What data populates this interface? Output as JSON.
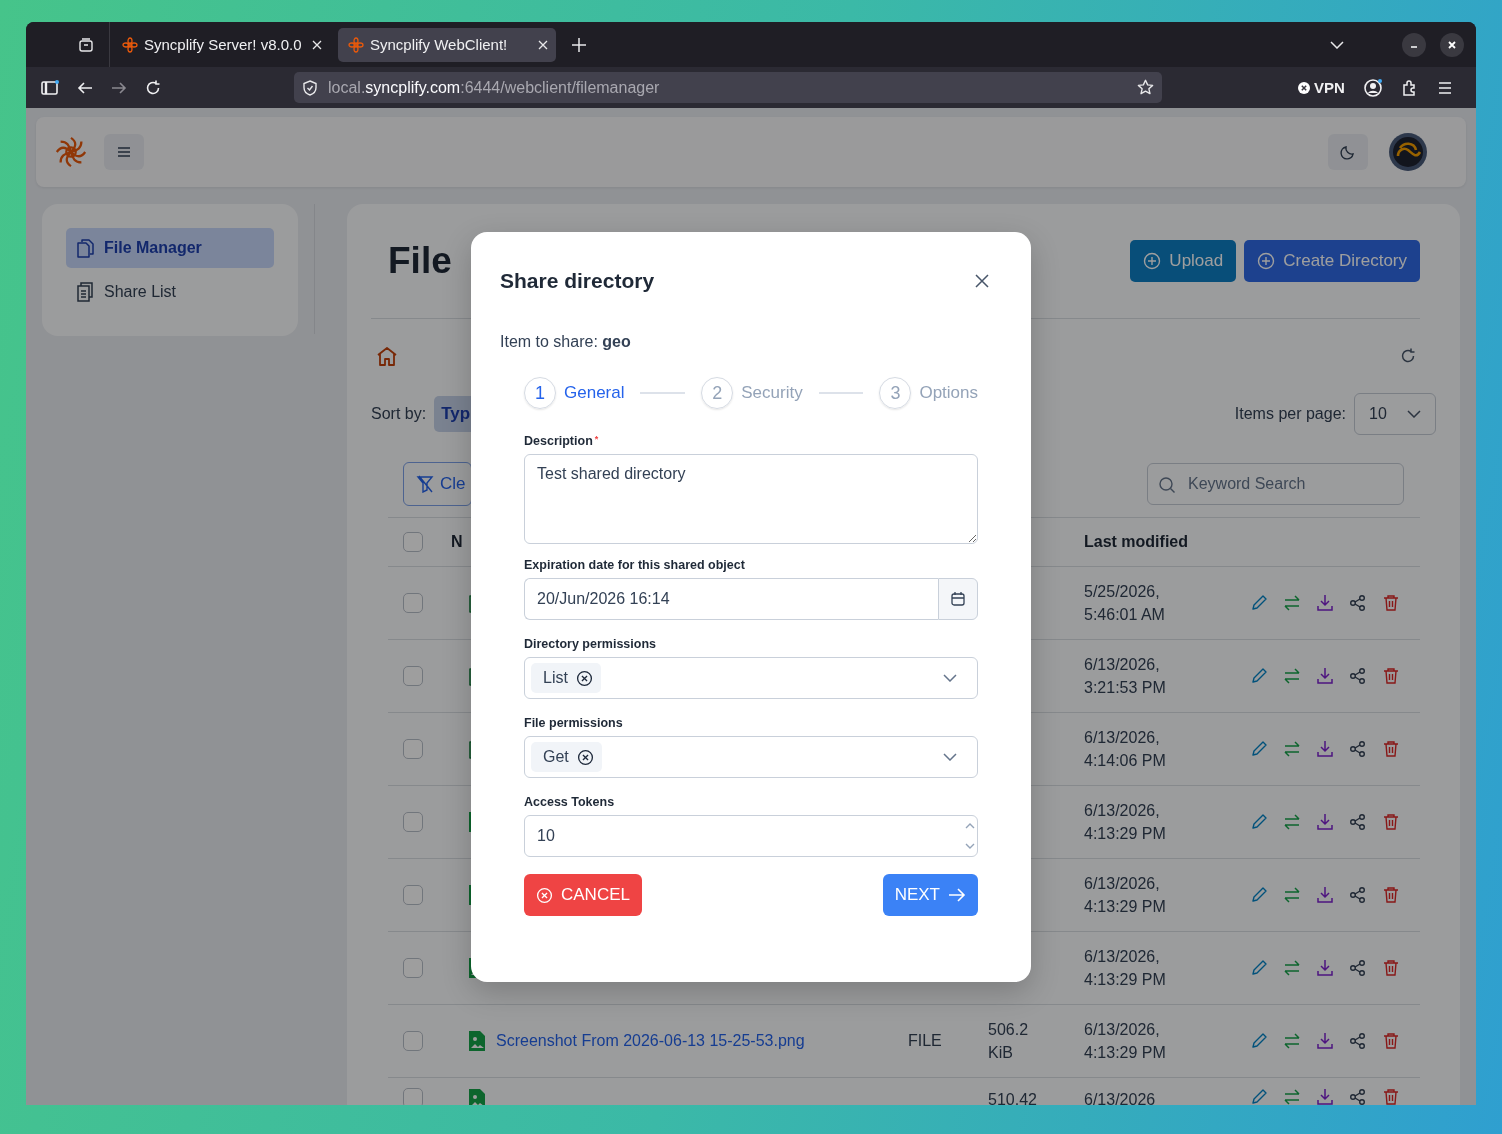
{
  "browser": {
    "tabs": [
      {
        "title": "Syncplify Server! v8.0.0",
        "selected": false
      },
      {
        "title": "Syncplify WebClient!",
        "selected": true
      }
    ],
    "address": {
      "prefix": "local.",
      "domain": "syncplify.com",
      "path": ":6444/webclient/filemanager"
    },
    "vpn": "VPN"
  },
  "sidebar": {
    "items": [
      {
        "label": "File Manager",
        "selected": true
      },
      {
        "label": "Share List",
        "selected": false
      }
    ]
  },
  "page": {
    "title": "File",
    "buttons": [
      {
        "label": "Upload",
        "kind": "upload"
      },
      {
        "label": "Create Directory",
        "kind": "create"
      }
    ],
    "sort": {
      "label": "Sort by:",
      "value": "Typ"
    },
    "items_per_page": {
      "label": "Items per page:",
      "value": "10"
    },
    "clear_filter": "Cle",
    "search": {
      "placeholder": "Keyword Search"
    },
    "table": {
      "name_column": "N",
      "modified_column": "Last modified",
      "all_checked": false,
      "rows": [
        {
          "kind": "folder",
          "checked": false,
          "modified": "5/25/2026, 5:46:01 AM"
        },
        {
          "kind": "folder",
          "checked": false,
          "modified": "6/13/2026, 3:21:53 PM"
        },
        {
          "kind": "folder",
          "checked": false,
          "modified": "6/13/2026, 4:14:06 PM"
        },
        {
          "kind": "image",
          "checked": false,
          "modified": "6/13/2026, 4:13:29 PM"
        },
        {
          "kind": "image",
          "checked": false,
          "modified": "6/13/2026, 4:13:29 PM"
        },
        {
          "kind": "image",
          "checked": false,
          "modified": "6/13/2026, 4:13:29 PM"
        },
        {
          "kind": "image",
          "checked": false,
          "name": "Screenshot From 2026-06-13 15-25-53.png",
          "type": "FILE",
          "size": "506.2 KiB",
          "modified": "6/13/2026, 4:13:29 PM"
        },
        {
          "kind": "image",
          "checked": false,
          "size": "510.42",
          "modified": "6/13/2026"
        }
      ]
    }
  },
  "dialog": {
    "title": "Share directory",
    "item": "Item to share: **geo**",
    "steps": [
      {
        "number": "1",
        "label": "General",
        "selected": true
      },
      {
        "number": "2",
        "label": "Security",
        "selected": false
      },
      {
        "number": "3",
        "label": "Options",
        "selected": false
      }
    ],
    "fields": [
      {
        "kind": "textarea",
        "label": "Description",
        "required_mark": "*",
        "value": "Test shared directory"
      },
      {
        "kind": "date",
        "label": "Expiration date for this shared object",
        "value": "20/Jun/2026 16:14"
      },
      {
        "kind": "tags",
        "label": "Directory permissions",
        "tags": [
          "List"
        ]
      },
      {
        "kind": "tags",
        "label": "File permissions",
        "tags": [
          "Get"
        ]
      },
      {
        "kind": "number",
        "label": "Access Tokens",
        "value": "10"
      }
    ],
    "cancel": "CANCEL",
    "next": "NEXT"
  }
}
